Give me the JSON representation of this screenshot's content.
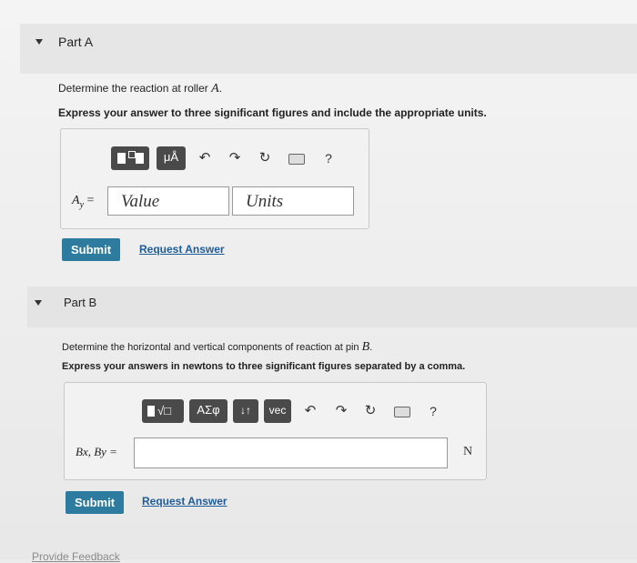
{
  "part_a": {
    "title": "Part A",
    "question": "Determine the reaction at roller ",
    "question_var": "A",
    "question_end": ".",
    "instruction": "Express your answer to three significant figures and include the appropriate units.",
    "toolbar": {
      "mu_a_label": "μÅ",
      "help_label": "?"
    },
    "answer_label": "A",
    "answer_label_sub": "y",
    "answer_label_eq": " =",
    "value_placeholder": "Value",
    "units_placeholder": "Units",
    "submit_label": "Submit",
    "request_label": "Request Answer"
  },
  "part_b": {
    "title": "Part B",
    "question": "Determine the horizontal and vertical components of reaction at pin ",
    "question_var": "B",
    "question_end": ".",
    "instruction": "Express your answers in newtons to three significant figures separated by a comma.",
    "toolbar": {
      "sigma_label": "ΑΣφ",
      "sort_label": "↓↑",
      "vec_label": "vec",
      "help_label": "?"
    },
    "answer_label": "Bx, By =",
    "unit": "N",
    "submit_label": "Submit",
    "request_label": "Request Answer"
  },
  "feedback_label": "Provide Feedback"
}
